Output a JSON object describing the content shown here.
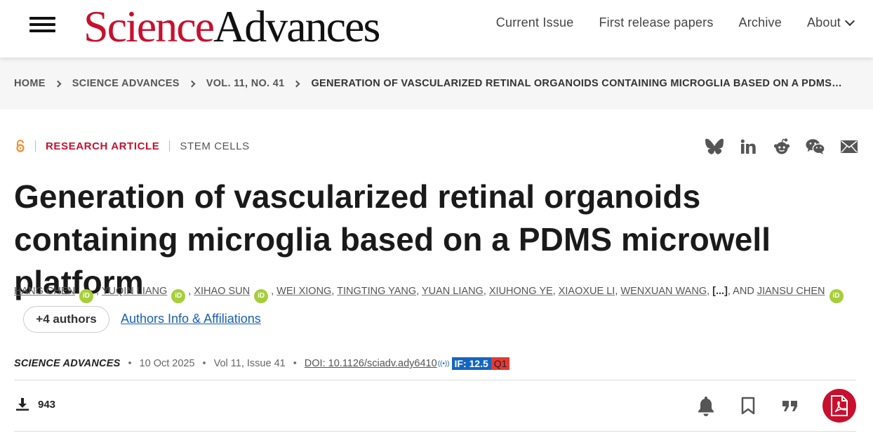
{
  "header": {
    "logo_part1": "Science",
    "logo_part2": "Advances",
    "nav": [
      "Current Issue",
      "First release papers",
      "Archive",
      "About"
    ]
  },
  "breadcrumb": [
    "HOME",
    "SCIENCE ADVANCES",
    "VOL. 11, NO. 41",
    "GENERATION OF VASCULARIZED RETINAL ORGANOIDS CONTAINING MICROGLIA BASED ON A PDMS…"
  ],
  "article": {
    "type": "RESEARCH ARTICLE",
    "subject": "STEM CELLS",
    "title": "Generation of vascularized retinal organoids containing microglia based on a PDMS microwell platform",
    "authors": [
      "HANG CHEN",
      "YUQIN LIANG",
      "XIHAO SUN",
      "WEI XIONG",
      "TINGTING YANG",
      "YUAN LIANG",
      "XIUHONG YE",
      "XIAOXUE LI",
      "WENXUAN WANG"
    ],
    "authors_ellipsis": "[...]",
    "authors_and": ", AND",
    "last_author": "JIANSU CHEN",
    "orcid_label": "iD",
    "more_authors": "+4 authors",
    "affiliations_link": "Authors Info & Affiliations",
    "journal": "SCIENCE ADVANCES",
    "date": "10 Oct 2025",
    "volume": "Vol 11, Issue 41",
    "doi": "DOI: 10.1126/sciadv.ady6410",
    "impact_factor": "IF: 12.5",
    "quartile": "Q1",
    "downloads": "943"
  },
  "icons": {
    "share": [
      "bluesky-icon",
      "linkedin-icon",
      "reddit-icon",
      "wechat-icon",
      "email-icon"
    ],
    "actions": [
      "bell-icon",
      "bookmark-icon",
      "quote-icon",
      "pdf-icon"
    ]
  },
  "colors": {
    "brand_red": "#c8102e",
    "link_blue": "#1a5fb4",
    "orcid_green": "#a6ce39",
    "if_blue": "#1565c0",
    "q1_red": "#e53935"
  }
}
